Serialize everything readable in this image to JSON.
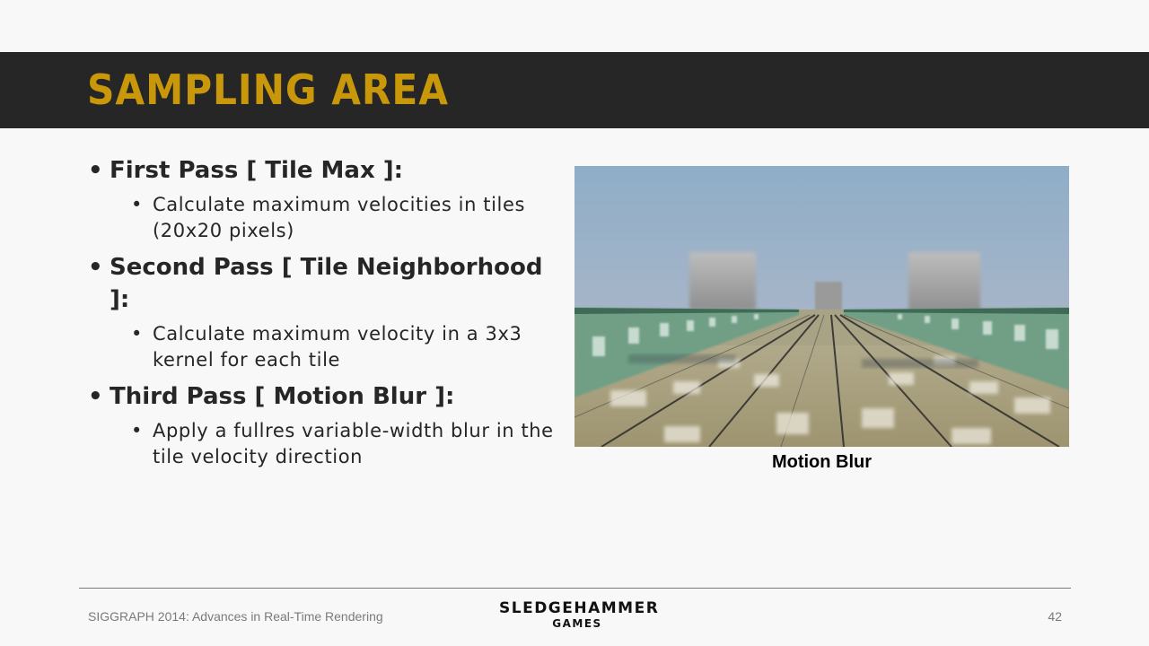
{
  "slide": {
    "title": "SAMPLING AREA",
    "bullets": [
      {
        "text": "First Pass [ Tile Max ]:",
        "sub": [
          "Calculate maximum velocities in tiles (20x20 pixels)"
        ]
      },
      {
        "text": "Second Pass [ Tile Neighborhood ]:",
        "sub": [
          "Calculate maximum velocity in a 3x3 kernel for each tile"
        ]
      },
      {
        "text": "Third Pass [ Motion Blur ]:",
        "sub": [
          "Apply a fullres variable-width blur in the tile velocity direction"
        ]
      }
    ],
    "figure_caption": "Motion Blur"
  },
  "footer": {
    "left": "SIGGRAPH 2014: Advances in Real-Time Rendering",
    "logo_line1": "SLEDGEHAMMER",
    "logo_line2": "GAMES",
    "page_number": "42"
  },
  "colors": {
    "title_bar": "#262626",
    "title_text": "#c9980a",
    "background": "#f8f8f8"
  }
}
